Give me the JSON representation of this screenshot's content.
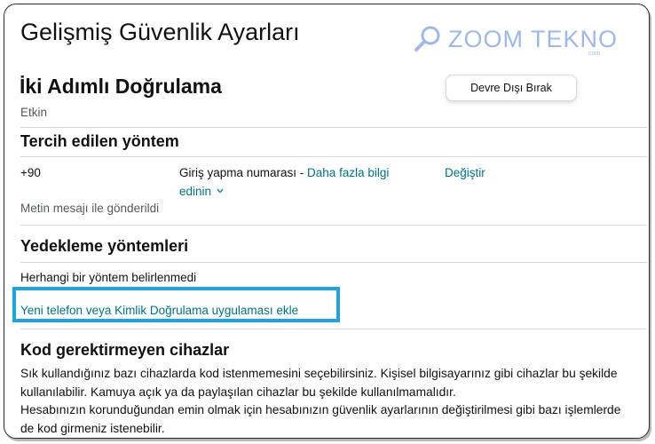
{
  "page": {
    "title": "Gelişmiş Güvenlik Ayarları"
  },
  "watermark": {
    "brand": "ZOOM TEKNO",
    "sub": ".com",
    "icon": "magnifier-icon",
    "color": "#9fb8e8"
  },
  "two_step": {
    "heading": "İki Adımlı Doğrulama",
    "status": "Etkin",
    "disable_button": "Devre Dışı Bırak"
  },
  "preferred": {
    "heading": "Tercih edilen yöntem",
    "phone_prefix": "+90",
    "description": "Giriş yapma numarası - ",
    "learn_more_line1": "Daha fazla bilgi",
    "learn_more_line2": "edinin",
    "chevron": "chevron-down-icon",
    "change_link": "Değiştir",
    "delivery_note": "Metin mesajı ile gönderildi"
  },
  "backup": {
    "heading": "Yedekleme yöntemleri",
    "none_text": "Herhangi bir yöntem belirlenmedi",
    "add_link": "Yeni telefon veya Kimlik Doğrulama uygulaması ekle"
  },
  "trusted_devices": {
    "heading": "Kod gerektirmeyen cihazlar",
    "line1": "Sık kullandığınız bazı cihazlarda kod istenmemesini seçebilirsiniz. Kişisel bilgisayarınız gibi cihazlar bu şekilde",
    "line2": "kullanılabilir. Kamuya açık ya da paylaşılan cihazlar bu şekilde kullanılmamalıdır.",
    "line3": "Hesabınızın korunduğundan emin olmak için hesabınızın güvenlik ayarlarının değiştirilmesi gibi bazı işlemlerde",
    "line4": "de kod girmeniz istenebilir."
  },
  "colors": {
    "link": "#007185",
    "highlight": "#1fa3e0",
    "divider": "#d5d9d9"
  }
}
